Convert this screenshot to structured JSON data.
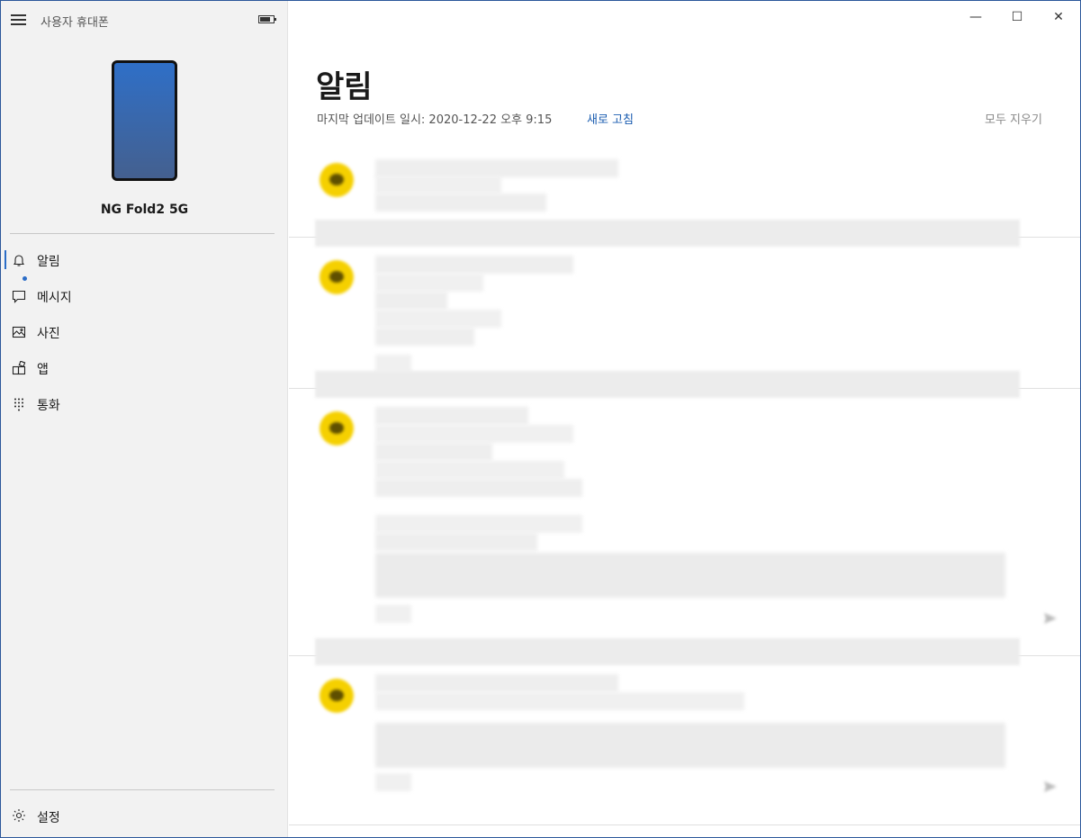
{
  "sidebar": {
    "app_title": "사용자 휴대폰",
    "device_name": "NG Fold2 5G",
    "nav": [
      {
        "label": "알림",
        "icon": "bell-icon",
        "active": true
      },
      {
        "label": "메시지",
        "icon": "message-icon",
        "has_badge": true
      },
      {
        "label": "사진",
        "icon": "photo-icon"
      },
      {
        "label": "앱",
        "icon": "apps-icon"
      },
      {
        "label": "통화",
        "icon": "dialpad-icon"
      }
    ],
    "settings_label": "설정"
  },
  "window": {
    "minimize": "—",
    "maximize": "☐",
    "close": "✕"
  },
  "main": {
    "title": "알림",
    "updated": "마지막 업데이트 일시: 2020-12-22 오후 9:15",
    "refresh": "새로 고침",
    "clear_all": "모두 지우기"
  },
  "colors": {
    "accent": "#2b6dc7",
    "kakao_yellow": "#f5d000",
    "sidebar_bg": "#f2f2f2"
  }
}
